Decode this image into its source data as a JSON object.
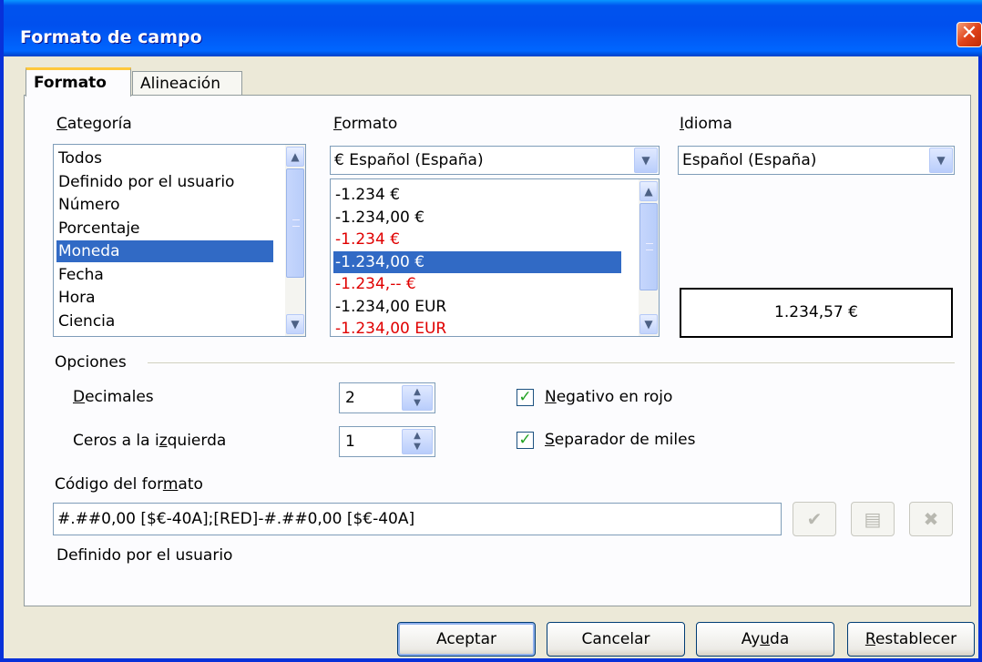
{
  "window": {
    "title": "Formato de campo",
    "close_label": "✕"
  },
  "tabs": [
    {
      "label": "Formato"
    },
    {
      "label": "Alineación"
    }
  ],
  "categoria": {
    "label": "Categoría",
    "items": [
      "Todos",
      "Definido por el usuario",
      "Número",
      "Porcentaje",
      "Moneda",
      "Fecha",
      "Hora",
      "Ciencia"
    ],
    "selected": "Moneda"
  },
  "formato": {
    "label": "Formato",
    "combo_value": "€ Español (España)",
    "items": [
      {
        "text": "-1.234 €",
        "red": false
      },
      {
        "text": "-1.234,00 €",
        "red": false
      },
      {
        "text": "-1.234 €",
        "red": true
      },
      {
        "text": "-1.234,00 €",
        "red": true,
        "selected": true
      },
      {
        "text": "-1.234,-- €",
        "red": true
      },
      {
        "text": "-1.234,00 EUR",
        "red": false
      },
      {
        "text": "-1.234,00 EUR",
        "red": true
      }
    ]
  },
  "idioma": {
    "label": "Idioma",
    "combo_value": "Español (España)"
  },
  "preview": {
    "value": "1.234,57 €"
  },
  "opciones": {
    "label": "Opciones",
    "decimales_label": "Decimales",
    "decimales_value": "2",
    "ceros_label": "Ceros a la izquierda",
    "ceros_value": "1",
    "negativo_label": "Negativo en rojo",
    "negativo_checked": true,
    "separador_label": "Separador de miles",
    "separador_checked": true
  },
  "codigo": {
    "label": "Código del formato",
    "value": "#.##0,00 [$€-40A];[RED]-#.##0,00 [$€-40A]",
    "description": "Definido por el usuario"
  },
  "buttons": {
    "aceptar": "Aceptar",
    "cancelar": "Cancelar",
    "ayuda": "Ayuda",
    "restablecer": "Restablecer"
  },
  "colors": {
    "title_bar": "#0054e3",
    "selection": "#316ac5",
    "negative": "#e00000",
    "check": "#21a121"
  }
}
